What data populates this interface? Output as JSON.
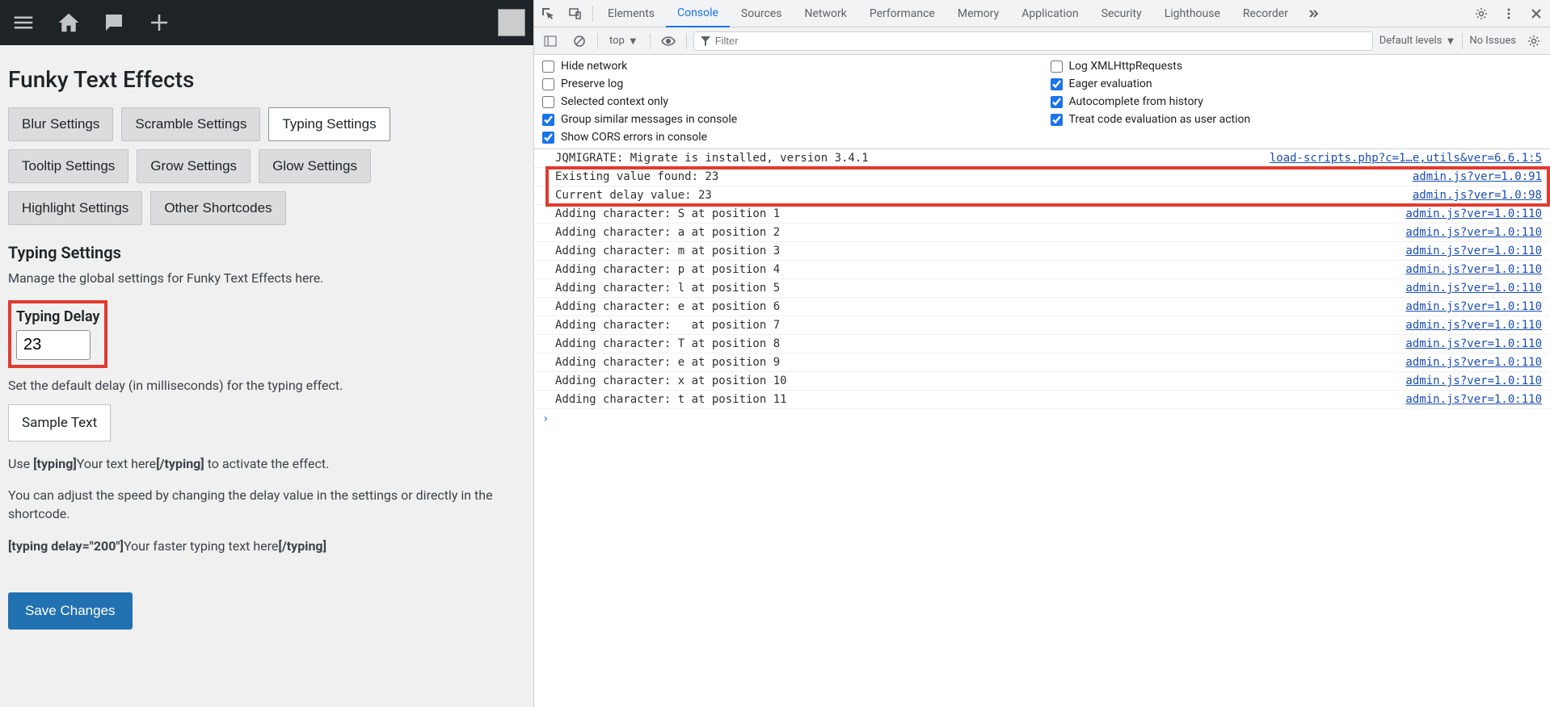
{
  "wp": {
    "title": "Funky Text Effects",
    "tabs_row1": [
      "Blur Settings",
      "Scramble Settings",
      "Typing Settings"
    ],
    "tabs_row2": [
      "Tooltip Settings",
      "Grow Settings",
      "Glow Settings"
    ],
    "tabs_row3": [
      "Highlight Settings",
      "Other Shortcodes"
    ],
    "active_tab": "Typing Settings",
    "section_heading": "Typing Settings",
    "intro": "Manage the global settings for Funky Text Effects here.",
    "field_label": "Typing Delay",
    "field_value": "23",
    "help_text": "Set the default delay (in milliseconds) for the typing effect.",
    "sample_text": "Sample Text",
    "usage_pre": "Use ",
    "usage_open": "[typing]",
    "usage_mid": "Your text here",
    "usage_close": "[/typing]",
    "usage_post": " to activate the effect.",
    "adjust_text": "You can adjust the speed by changing the delay value in the settings or directly in the shortcode.",
    "example_open": "[typing delay=\"200\"]",
    "example_mid": "Your faster typing text here",
    "example_close": "[/typing]",
    "save_label": "Save Changes"
  },
  "devtools": {
    "tabs": [
      "Elements",
      "Console",
      "Sources",
      "Network",
      "Performance",
      "Memory",
      "Application",
      "Security",
      "Lighthouse",
      "Recorder"
    ],
    "active_tab": "Console",
    "context": "top",
    "filter_placeholder": "Filter",
    "levels": "Default levels",
    "issues": "No Issues",
    "settings_left": [
      {
        "label": "Hide network",
        "checked": false
      },
      {
        "label": "Preserve log",
        "checked": false
      },
      {
        "label": "Selected context only",
        "checked": false
      },
      {
        "label": "Group similar messages in console",
        "checked": true
      },
      {
        "label": "Show CORS errors in console",
        "checked": true
      }
    ],
    "settings_right": [
      {
        "label": "Log XMLHttpRequests",
        "checked": false
      },
      {
        "label": "Eager evaluation",
        "checked": true
      },
      {
        "label": "Autocomplete from history",
        "checked": true
      },
      {
        "label": "Treat code evaluation as user action",
        "checked": true
      }
    ],
    "logs": [
      {
        "msg": "JQMIGRATE: Migrate is installed, version 3.4.1",
        "src": "load-scripts.php?c=1…e,utils&ver=6.6.1:5"
      },
      {
        "msg": "Existing value found: 23",
        "src": "admin.js?ver=1.0:91",
        "hl": true
      },
      {
        "msg": "Current delay value: 23",
        "src": "admin.js?ver=1.0:98",
        "hl": true
      },
      {
        "msg": "Adding character: S at position 1",
        "src": "admin.js?ver=1.0:110"
      },
      {
        "msg": "Adding character: a at position 2",
        "src": "admin.js?ver=1.0:110"
      },
      {
        "msg": "Adding character: m at position 3",
        "src": "admin.js?ver=1.0:110"
      },
      {
        "msg": "Adding character: p at position 4",
        "src": "admin.js?ver=1.0:110"
      },
      {
        "msg": "Adding character: l at position 5",
        "src": "admin.js?ver=1.0:110"
      },
      {
        "msg": "Adding character: e at position 6",
        "src": "admin.js?ver=1.0:110"
      },
      {
        "msg": "Adding character:   at position 7",
        "src": "admin.js?ver=1.0:110"
      },
      {
        "msg": "Adding character: T at position 8",
        "src": "admin.js?ver=1.0:110"
      },
      {
        "msg": "Adding character: e at position 9",
        "src": "admin.js?ver=1.0:110"
      },
      {
        "msg": "Adding character: x at position 10",
        "src": "admin.js?ver=1.0:110"
      },
      {
        "msg": "Adding character: t at position 11",
        "src": "admin.js?ver=1.0:110"
      }
    ]
  }
}
